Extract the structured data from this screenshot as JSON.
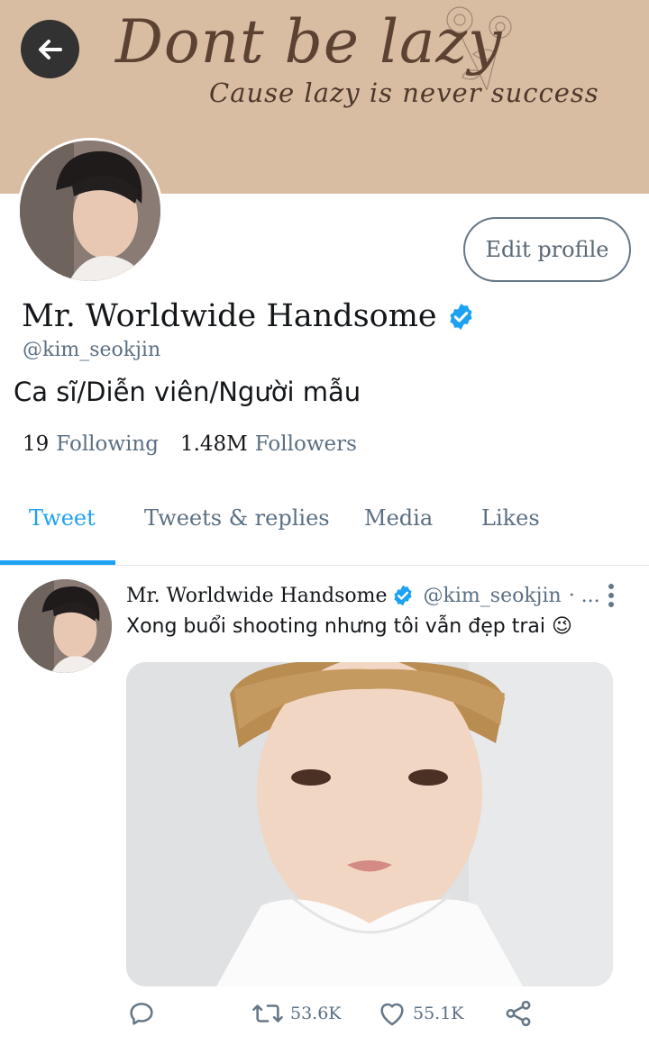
{
  "banner": {
    "title": "Dont be lazy",
    "subtitle": "Cause lazy is never success"
  },
  "profile": {
    "name": "Mr. Worldwide Handsome",
    "handle": "@kim_seokjin",
    "bio": "Ca sĩ/Diễn viên/Người mẫu",
    "edit_label": "Edit profile",
    "following_count": "19",
    "following_label": "Following",
    "followers_count": "1.48M",
    "followers_label": "Followers"
  },
  "tabs": [
    {
      "label": "Tweet",
      "active": true
    },
    {
      "label": "Tweets & replies",
      "active": false
    },
    {
      "label": "Media",
      "active": false
    },
    {
      "label": "Likes",
      "active": false
    }
  ],
  "tweet": {
    "name": "Mr. Worldwide Handsome",
    "handle": "@kim_seokjin",
    "separator": "· ...",
    "text": "Xong buổi shooting nhưng tôi vẫn đẹp trai 😉",
    "retweets": "53.6K",
    "likes": "55.1K"
  },
  "colors": {
    "accent": "#1da1f2",
    "banner": "#d8bda3",
    "muted": "#5b7083"
  },
  "icons": [
    "back-arrow-icon",
    "verified-badge-icon",
    "more-vertical-icon",
    "reply-icon",
    "retweet-icon",
    "like-icon",
    "share-icon"
  ]
}
